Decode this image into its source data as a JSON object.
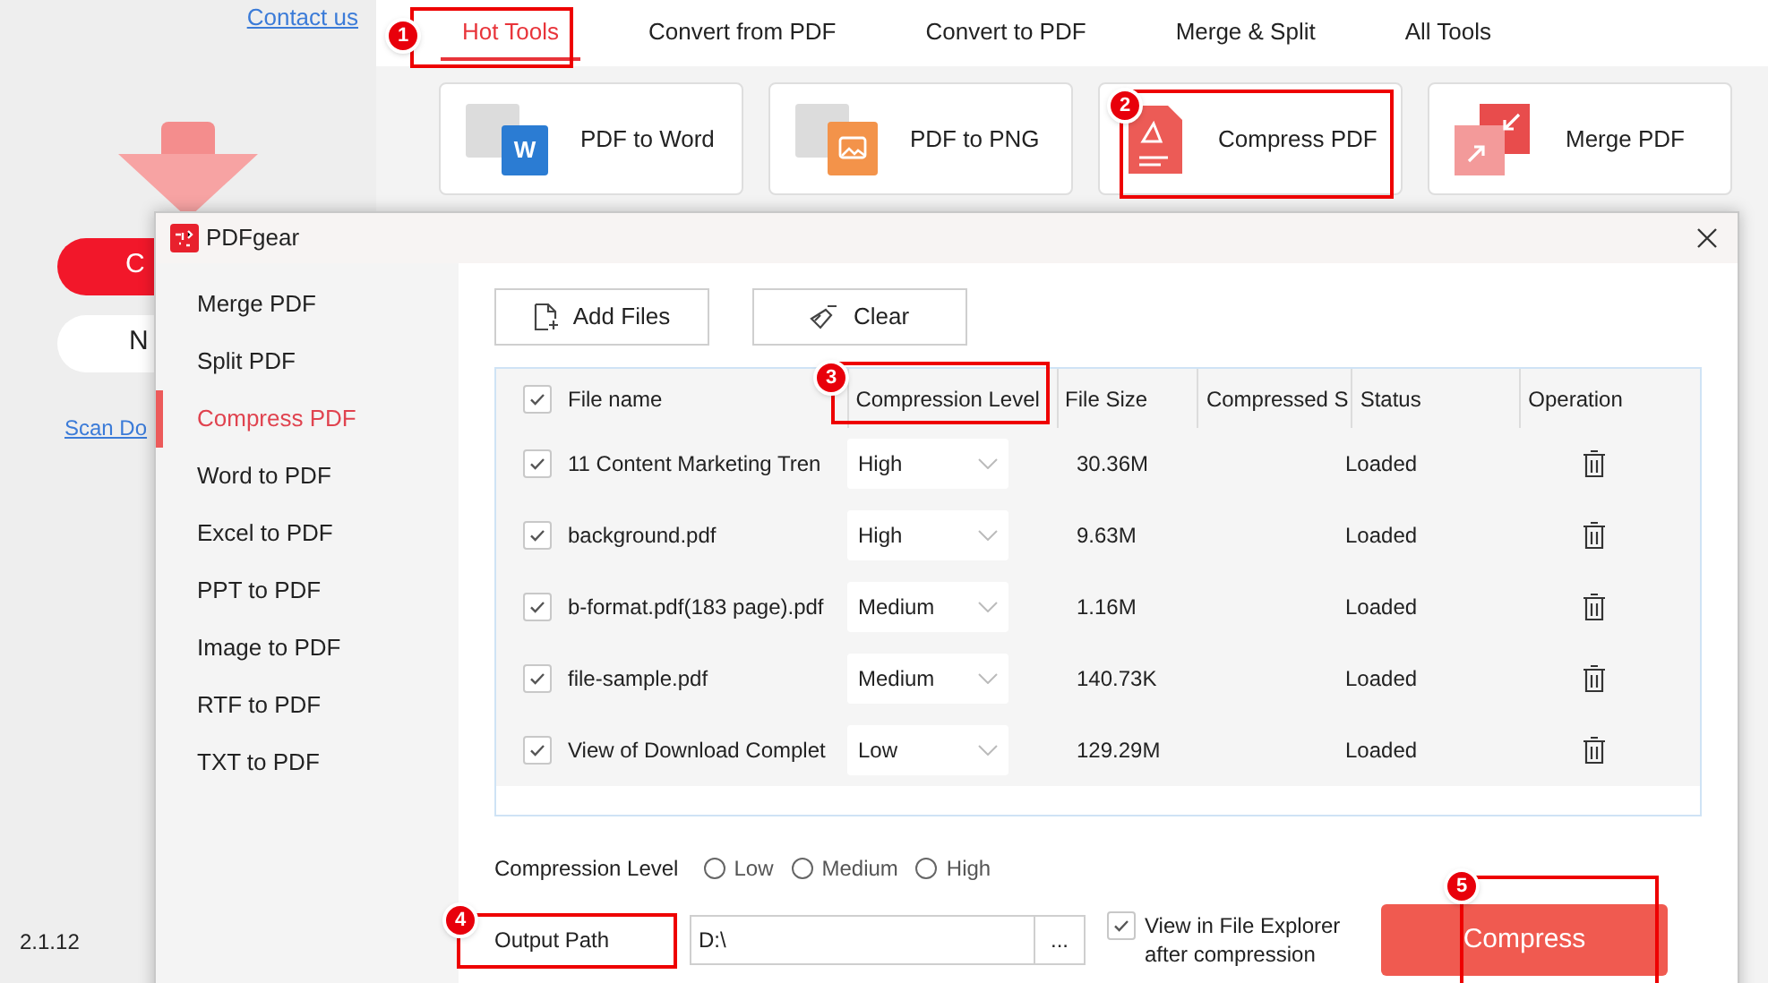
{
  "app": {
    "contact_link": "Contact us",
    "primary_button": "C",
    "secondary_button": "N",
    "scan_link": "Scan Do",
    "version": "2.1.12"
  },
  "tabs": [
    {
      "label": "Hot Tools",
      "selected": true
    },
    {
      "label": "Convert from PDF",
      "selected": false
    },
    {
      "label": "Convert to PDF",
      "selected": false
    },
    {
      "label": "Merge & Split",
      "selected": false
    },
    {
      "label": "All Tools",
      "selected": false
    }
  ],
  "tool_cards": [
    {
      "label": "PDF to Word",
      "kind": "word",
      "badge": "W"
    },
    {
      "label": "PDF to PNG",
      "kind": "png"
    },
    {
      "label": "Compress PDF",
      "kind": "compress"
    },
    {
      "label": "Merge PDF",
      "kind": "merge"
    }
  ],
  "dialog": {
    "title": "PDFgear",
    "sidebar": [
      {
        "label": "Merge PDF",
        "selected": false
      },
      {
        "label": "Split PDF",
        "selected": false
      },
      {
        "label": "Compress PDF",
        "selected": true
      },
      {
        "label": "Word to PDF",
        "selected": false
      },
      {
        "label": "Excel to PDF",
        "selected": false
      },
      {
        "label": "PPT to PDF",
        "selected": false
      },
      {
        "label": "Image to PDF",
        "selected": false
      },
      {
        "label": "RTF to PDF",
        "selected": false
      },
      {
        "label": "TXT to PDF",
        "selected": false
      }
    ],
    "add_button": "Add Files",
    "clear_button": "Clear",
    "table": {
      "all_checked": true,
      "columns": [
        "File name",
        "Compression Level",
        "File Size",
        "Compressed S",
        "Status",
        "Operation"
      ],
      "rows": [
        {
          "checked": true,
          "name": "11 Content Marketing Tren",
          "level": "High",
          "size": "30.36M",
          "status": "Loaded"
        },
        {
          "checked": true,
          "name": "background.pdf",
          "level": "High",
          "size": "9.63M",
          "status": "Loaded"
        },
        {
          "checked": true,
          "name": "b-format.pdf(183 page).pdf",
          "level": "Medium",
          "size": "1.16M",
          "status": "Loaded"
        },
        {
          "checked": true,
          "name": "file-sample.pdf",
          "level": "Medium",
          "size": "140.73K",
          "status": "Loaded"
        },
        {
          "checked": true,
          "name": "View of Download Complet",
          "level": "Low",
          "size": "129.29M",
          "status": "Loaded"
        }
      ]
    },
    "compression_level": {
      "label": "Compression Level",
      "options": [
        {
          "label": "Low",
          "selected": false
        },
        {
          "label": "Medium",
          "selected": false
        },
        {
          "label": "High",
          "selected": false
        }
      ]
    },
    "output": {
      "label": "Output Path",
      "value": "D:\\",
      "browse": "...",
      "open_after": {
        "label": "View in File Explorer after compression",
        "checked": true
      }
    },
    "compress_button": "Compress"
  },
  "annotations": [
    {
      "number": "1"
    },
    {
      "number": "2"
    },
    {
      "number": "3"
    },
    {
      "number": "4"
    },
    {
      "number": "5"
    }
  ]
}
